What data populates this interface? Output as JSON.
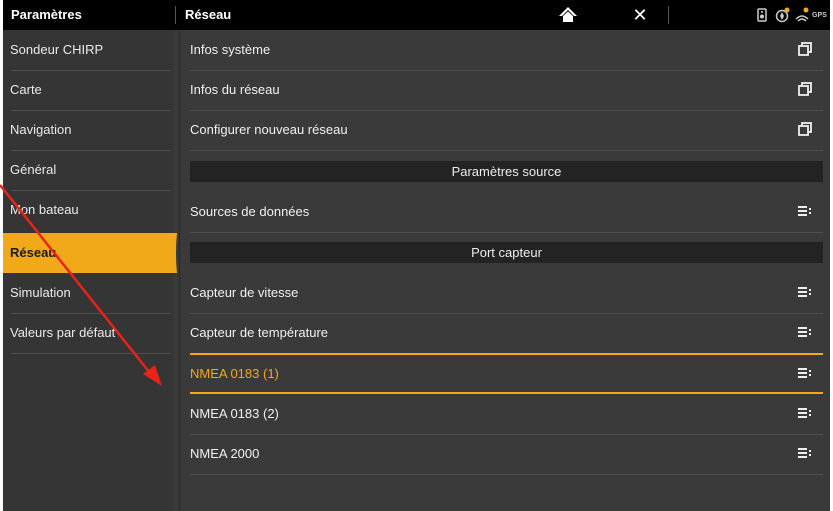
{
  "topbar": {
    "left_title": "Paramètres",
    "right_title": "Réseau",
    "home_icon": "home-icon",
    "close_icon": "close-icon",
    "close_glyph": "✕",
    "status_icons": [
      "speaker-icon",
      "compass-icon",
      "satellite-icon"
    ],
    "gps_label": "GPS"
  },
  "sidebar": {
    "items": [
      {
        "label": "Sondeur CHIRP"
      },
      {
        "label": "Carte"
      },
      {
        "label": "Navigation"
      },
      {
        "label": "Général"
      },
      {
        "label": "Mon bateau"
      },
      {
        "label": "Réseau",
        "active": true
      },
      {
        "label": "Simulation"
      },
      {
        "label": "Valeurs par défaut"
      }
    ]
  },
  "main": {
    "rows": [
      {
        "label": "Infos système",
        "icon": "window-icon"
      },
      {
        "label": "Infos du réseau",
        "icon": "window-icon"
      },
      {
        "label": "Configurer nouveau réseau",
        "icon": "window-icon"
      }
    ],
    "section_source": "Paramètres source",
    "source_rows": [
      {
        "label": "Sources de données",
        "icon": "list-menu-icon"
      }
    ],
    "section_port": "Port capteur",
    "port_rows": [
      {
        "label": "Capteur de vitesse",
        "icon": "list-menu-icon"
      },
      {
        "label": "Capteur de température",
        "icon": "list-menu-icon"
      },
      {
        "label": "NMEA 0183 (1)",
        "icon": "list-menu-icon",
        "selected": true
      },
      {
        "label": "NMEA 0183 (2)",
        "icon": "list-menu-icon"
      },
      {
        "label": "NMEA 2000",
        "icon": "list-menu-icon"
      }
    ]
  },
  "colors": {
    "accent": "#f1a91a",
    "annotation_arrow": "#e8231a",
    "topbar": "#000000",
    "panel": "#3a3a3a",
    "section_bar": "#232323"
  }
}
